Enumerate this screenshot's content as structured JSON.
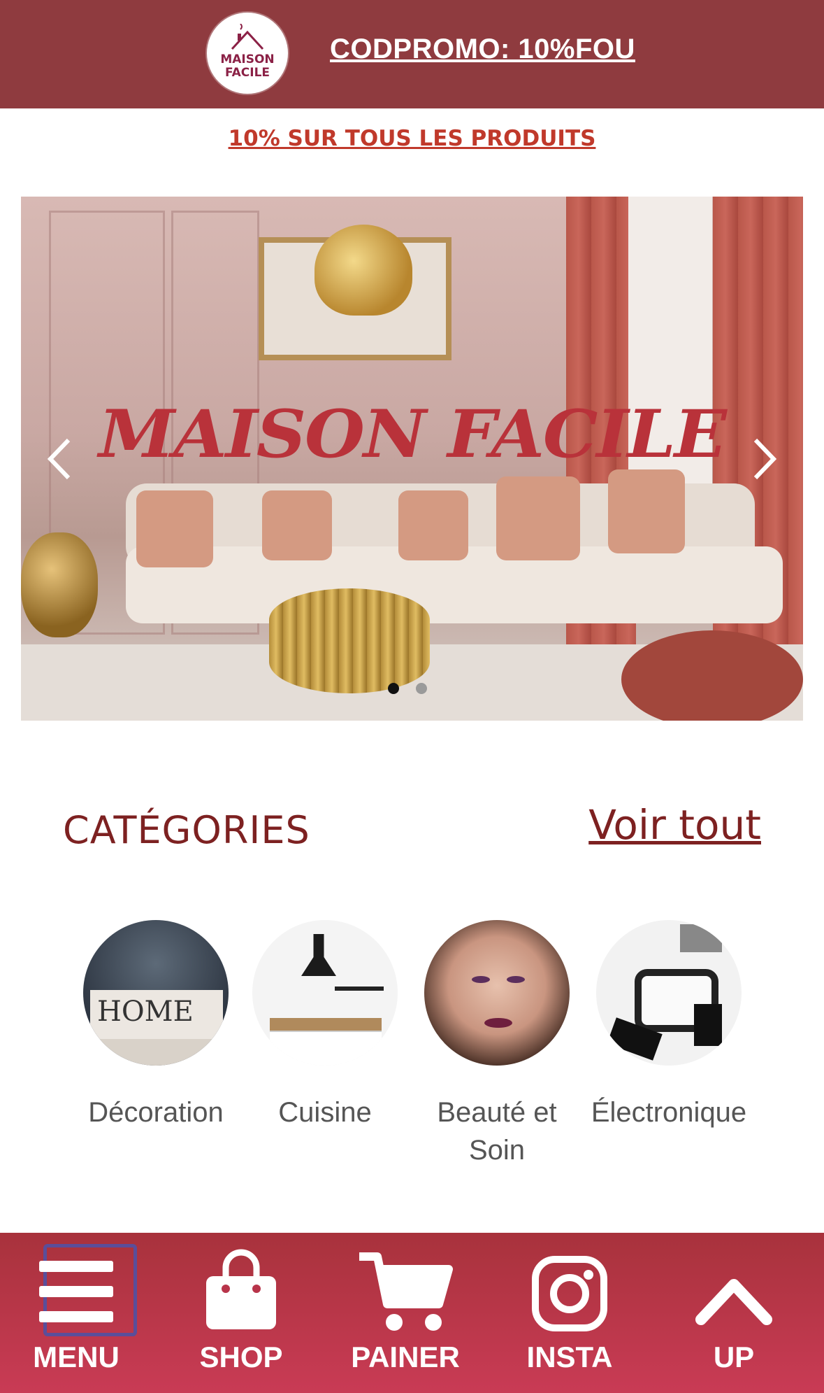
{
  "header": {
    "logo_line1": "MAISON",
    "logo_line2": "FACILE",
    "promo_code": "CODPROMO: 10%FOU",
    "subpromo": "10% SUR TOUS LES PRODUITS"
  },
  "hero": {
    "title": "MAISON FACILE",
    "slide_count": 2,
    "active_slide": 1
  },
  "categories": {
    "title": "CATÉGORIES",
    "see_all": "Voir tout",
    "items": [
      {
        "label": "Décoration",
        "icon": "home-decor-image"
      },
      {
        "label": "Cuisine",
        "icon": "kitchen-image"
      },
      {
        "label": "Beauté et Soin",
        "icon": "beauty-image"
      },
      {
        "label": "Électronique",
        "icon": "electronics-image"
      }
    ]
  },
  "bottom_nav": {
    "items": [
      {
        "label": "MENU",
        "icon": "hamburger-icon"
      },
      {
        "label": "SHOP",
        "icon": "shopping-bag-icon"
      },
      {
        "label": "PAINER",
        "icon": "cart-icon"
      },
      {
        "label": "INSTA",
        "icon": "instagram-icon"
      },
      {
        "label": "UP",
        "icon": "chevron-up-icon"
      }
    ]
  },
  "colors": {
    "brand": "#8f3b3f",
    "accent_red": "#c0392b",
    "title_dark_red": "#7d2121",
    "nav_bg": "#b8344a"
  }
}
